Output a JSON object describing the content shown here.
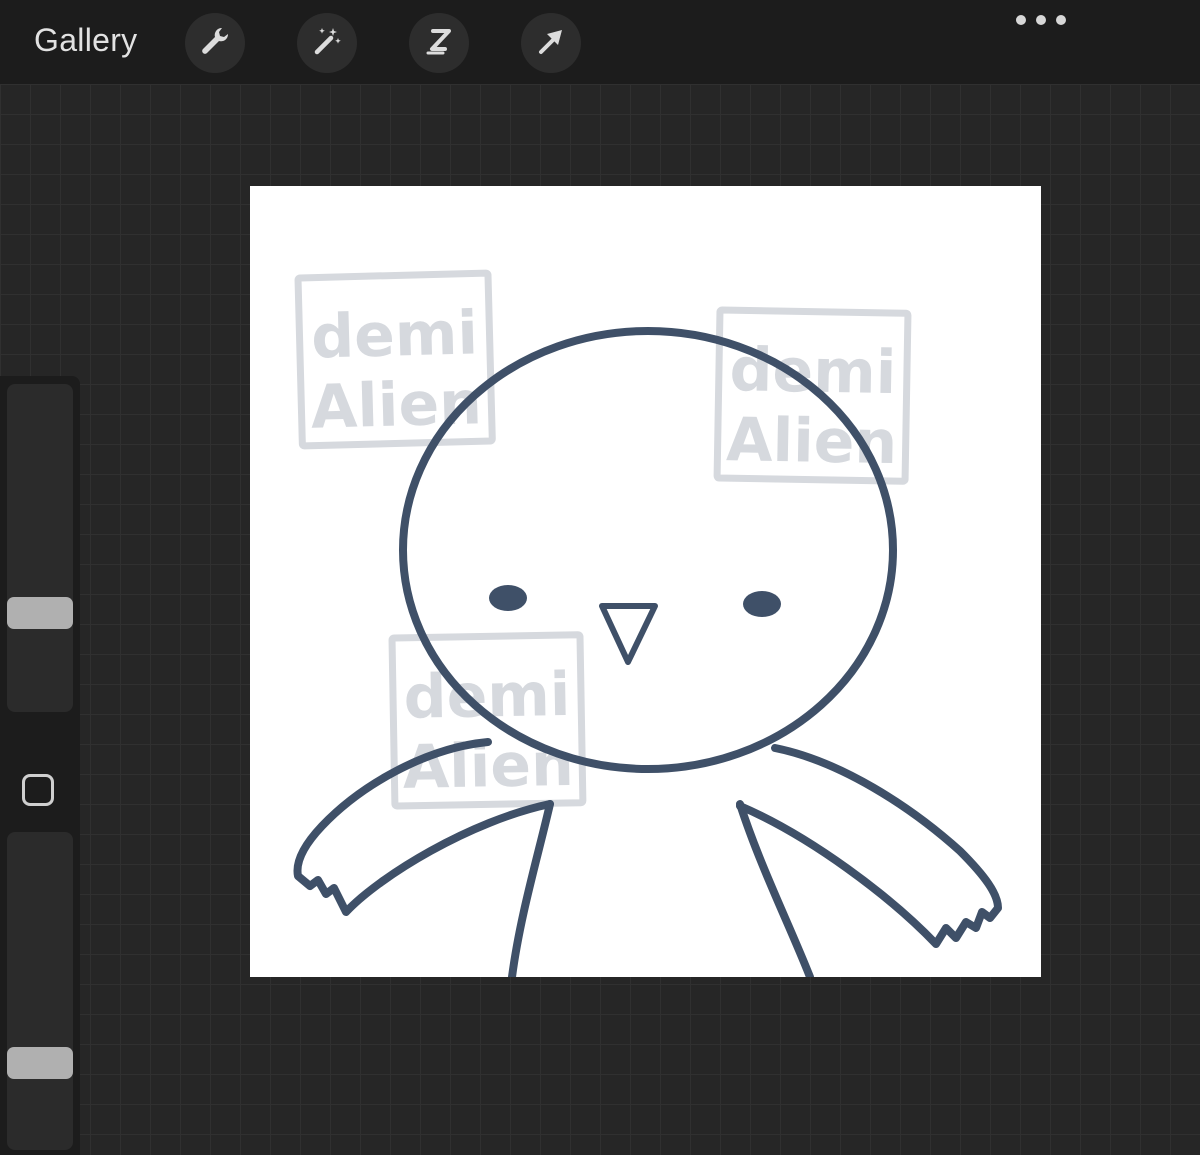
{
  "topbar": {
    "gallery_label": "Gallery",
    "tools": [
      {
        "name": "actions",
        "icon": "wrench-icon"
      },
      {
        "name": "adjustments",
        "icon": "magic-wand-icon"
      },
      {
        "name": "selection",
        "icon": "selection-s-icon"
      },
      {
        "name": "transform",
        "icon": "arrow-cursor-icon"
      }
    ],
    "more_icon": "more-dots-icon"
  },
  "sidebar": {
    "brush_size_level": 0.28,
    "opacity_level": 0.25,
    "modify_icon": "square-modify-icon"
  },
  "canvas": {
    "watermark_text_line1": "demi",
    "watermark_text_line2": "Alien",
    "colors": {
      "stroke": "#3f5068",
      "watermark": "#d6d9de",
      "background": "#ffffff"
    }
  }
}
